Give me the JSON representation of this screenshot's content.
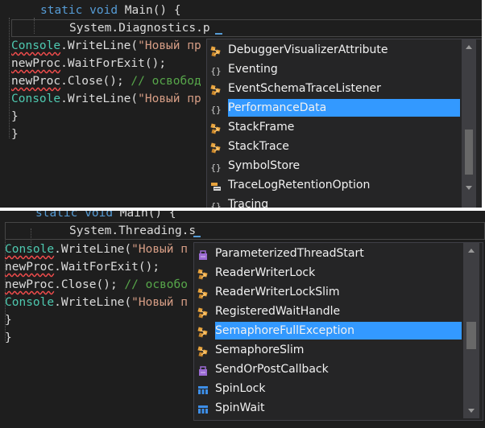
{
  "panel1": {
    "code": {
      "line1": {
        "kw1": "static",
        "kw2": "void",
        "rest": " Main() {"
      },
      "line2": {
        "ns": "System.Diagnostics.p"
      },
      "line3": {
        "obj": "Console",
        "method": ".WriteLine(",
        "str": "\"Новый пр"
      },
      "line4": {
        "obj": "newProc",
        "rest": ".WaitForExit();"
      },
      "line5": {
        "obj": "newProc",
        "rest": ".Close(); ",
        "comment": "// освобод"
      },
      "line6": {
        "obj": "Console",
        "method": ".WriteLine(",
        "str": "\"Новый пр"
      },
      "brace1": "}",
      "brace2": "}"
    },
    "completion": {
      "items": [
        {
          "label": "DebuggerVisualizerAttribute",
          "icon": "class-icon"
        },
        {
          "label": "Eventing",
          "icon": "namespace-icon"
        },
        {
          "label": "EventSchemaTraceListener",
          "icon": "class-icon"
        },
        {
          "label": "PerformanceData",
          "icon": "namespace-icon",
          "selected": true
        },
        {
          "label": "StackFrame",
          "icon": "class-icon"
        },
        {
          "label": "StackTrace",
          "icon": "class-icon"
        },
        {
          "label": "SymbolStore",
          "icon": "namespace-icon"
        },
        {
          "label": "TraceLogRetentionOption",
          "icon": "enum-icon"
        },
        {
          "label": "Tracing",
          "icon": "namespace-icon"
        }
      ]
    }
  },
  "panel2": {
    "code": {
      "line1": {
        "kw1": "static",
        "kw2": "void",
        "rest": " Main() {"
      },
      "line2": {
        "ns": "System.Threading.s"
      },
      "line3": {
        "obj": "Console",
        "method": ".WriteLine(",
        "str": "\"Новый п"
      },
      "line4": {
        "obj": "newProc",
        "rest": ".WaitForExit();"
      },
      "line5": {
        "obj": "newProc",
        "rest": ".Close(); ",
        "comment": "// освобо"
      },
      "line6": {
        "obj": "Console",
        "method": ".WriteLine(",
        "str": "\"Новый п"
      },
      "brace1": "}",
      "brace2": "}"
    },
    "completion": {
      "items": [
        {
          "label": "ParameterizedThreadStart",
          "icon": "delegate-icon"
        },
        {
          "label": "ReaderWriterLock",
          "icon": "class-icon"
        },
        {
          "label": "ReaderWriterLockSlim",
          "icon": "class-icon"
        },
        {
          "label": "RegisteredWaitHandle",
          "icon": "class-icon"
        },
        {
          "label": "SemaphoreFullException",
          "icon": "class-icon",
          "selected": true
        },
        {
          "label": "SemaphoreSlim",
          "icon": "class-icon"
        },
        {
          "label": "SendOrPostCallback",
          "icon": "delegate-icon"
        },
        {
          "label": "SpinLock",
          "icon": "struct-icon"
        },
        {
          "label": "SpinWait",
          "icon": "struct-icon"
        }
      ]
    }
  },
  "colors": {
    "background": "#1e1e1e",
    "keyword": "#569cd6",
    "string": "#d69d85",
    "comment": "#57a64a",
    "type": "#4ec9b0",
    "selection": "#3399ff",
    "popup": "#252526"
  }
}
